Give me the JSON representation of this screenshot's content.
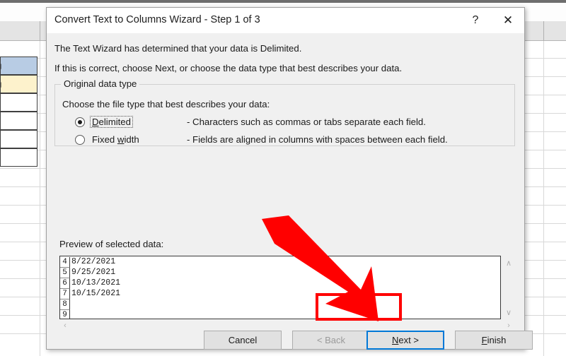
{
  "background": {
    "app": "excel-spreadsheet",
    "cells": [
      {
        "text": "g",
        "fill": "#b8cce4"
      },
      {
        "text": "g",
        "fill": "#fdf2cc"
      },
      {
        "text": "",
        "fill": "#ffffff"
      },
      {
        "text": "",
        "fill": "#ffffff"
      },
      {
        "text": "",
        "fill": "#ffffff"
      },
      {
        "text": "",
        "fill": "#ffffff"
      }
    ]
  },
  "dialog": {
    "title": "Convert Text to Columns Wizard - Step 1 of 3",
    "help_icon": "?",
    "close_icon": "✕",
    "description_line1": "The Text Wizard has determined that your data is Delimited.",
    "description_line2": "If this is correct, choose Next, or choose the data type that best describes your data.",
    "group": {
      "title": "Original data type",
      "instruction": "Choose the file type that best describes your data:",
      "options": [
        {
          "label": "Delimited",
          "accel": "D",
          "label_rest": "elimited",
          "description": "- Characters such as commas or tabs separate each field.",
          "selected": true,
          "focused": true
        },
        {
          "label": "Fixed width",
          "label_pre": "Fixed ",
          "accel": "w",
          "label_rest": "idth",
          "description": "- Fields are aligned in columns with spaces between each field.",
          "selected": false,
          "focused": false
        }
      ]
    },
    "preview": {
      "label": "Preview of selected data:",
      "rows": [
        {
          "number": "4",
          "value": "8/22/2021"
        },
        {
          "number": "5",
          "value": "9/25/2021"
        },
        {
          "number": "6",
          "value": "10/13/2021"
        },
        {
          "number": "7",
          "value": "10/15/2021"
        },
        {
          "number": "8",
          "value": ""
        },
        {
          "number": "9",
          "value": ""
        }
      ],
      "scroll_up_icon": "∧",
      "scroll_down_icon": "∨",
      "scroll_left_icon": "‹",
      "scroll_right_icon": "›"
    },
    "buttons": {
      "cancel": "Cancel",
      "back": "< Back",
      "next_pre": "N",
      "next_accel": "N",
      "next_rest": "ext >",
      "finish_accel": "F",
      "finish_rest": "inish",
      "back_disabled": true,
      "next_focused": true
    }
  },
  "annotation": {
    "color": "#ff0000",
    "arrow": "red-arrow-pointing-to-next-button",
    "highlight_target": "next-button"
  }
}
